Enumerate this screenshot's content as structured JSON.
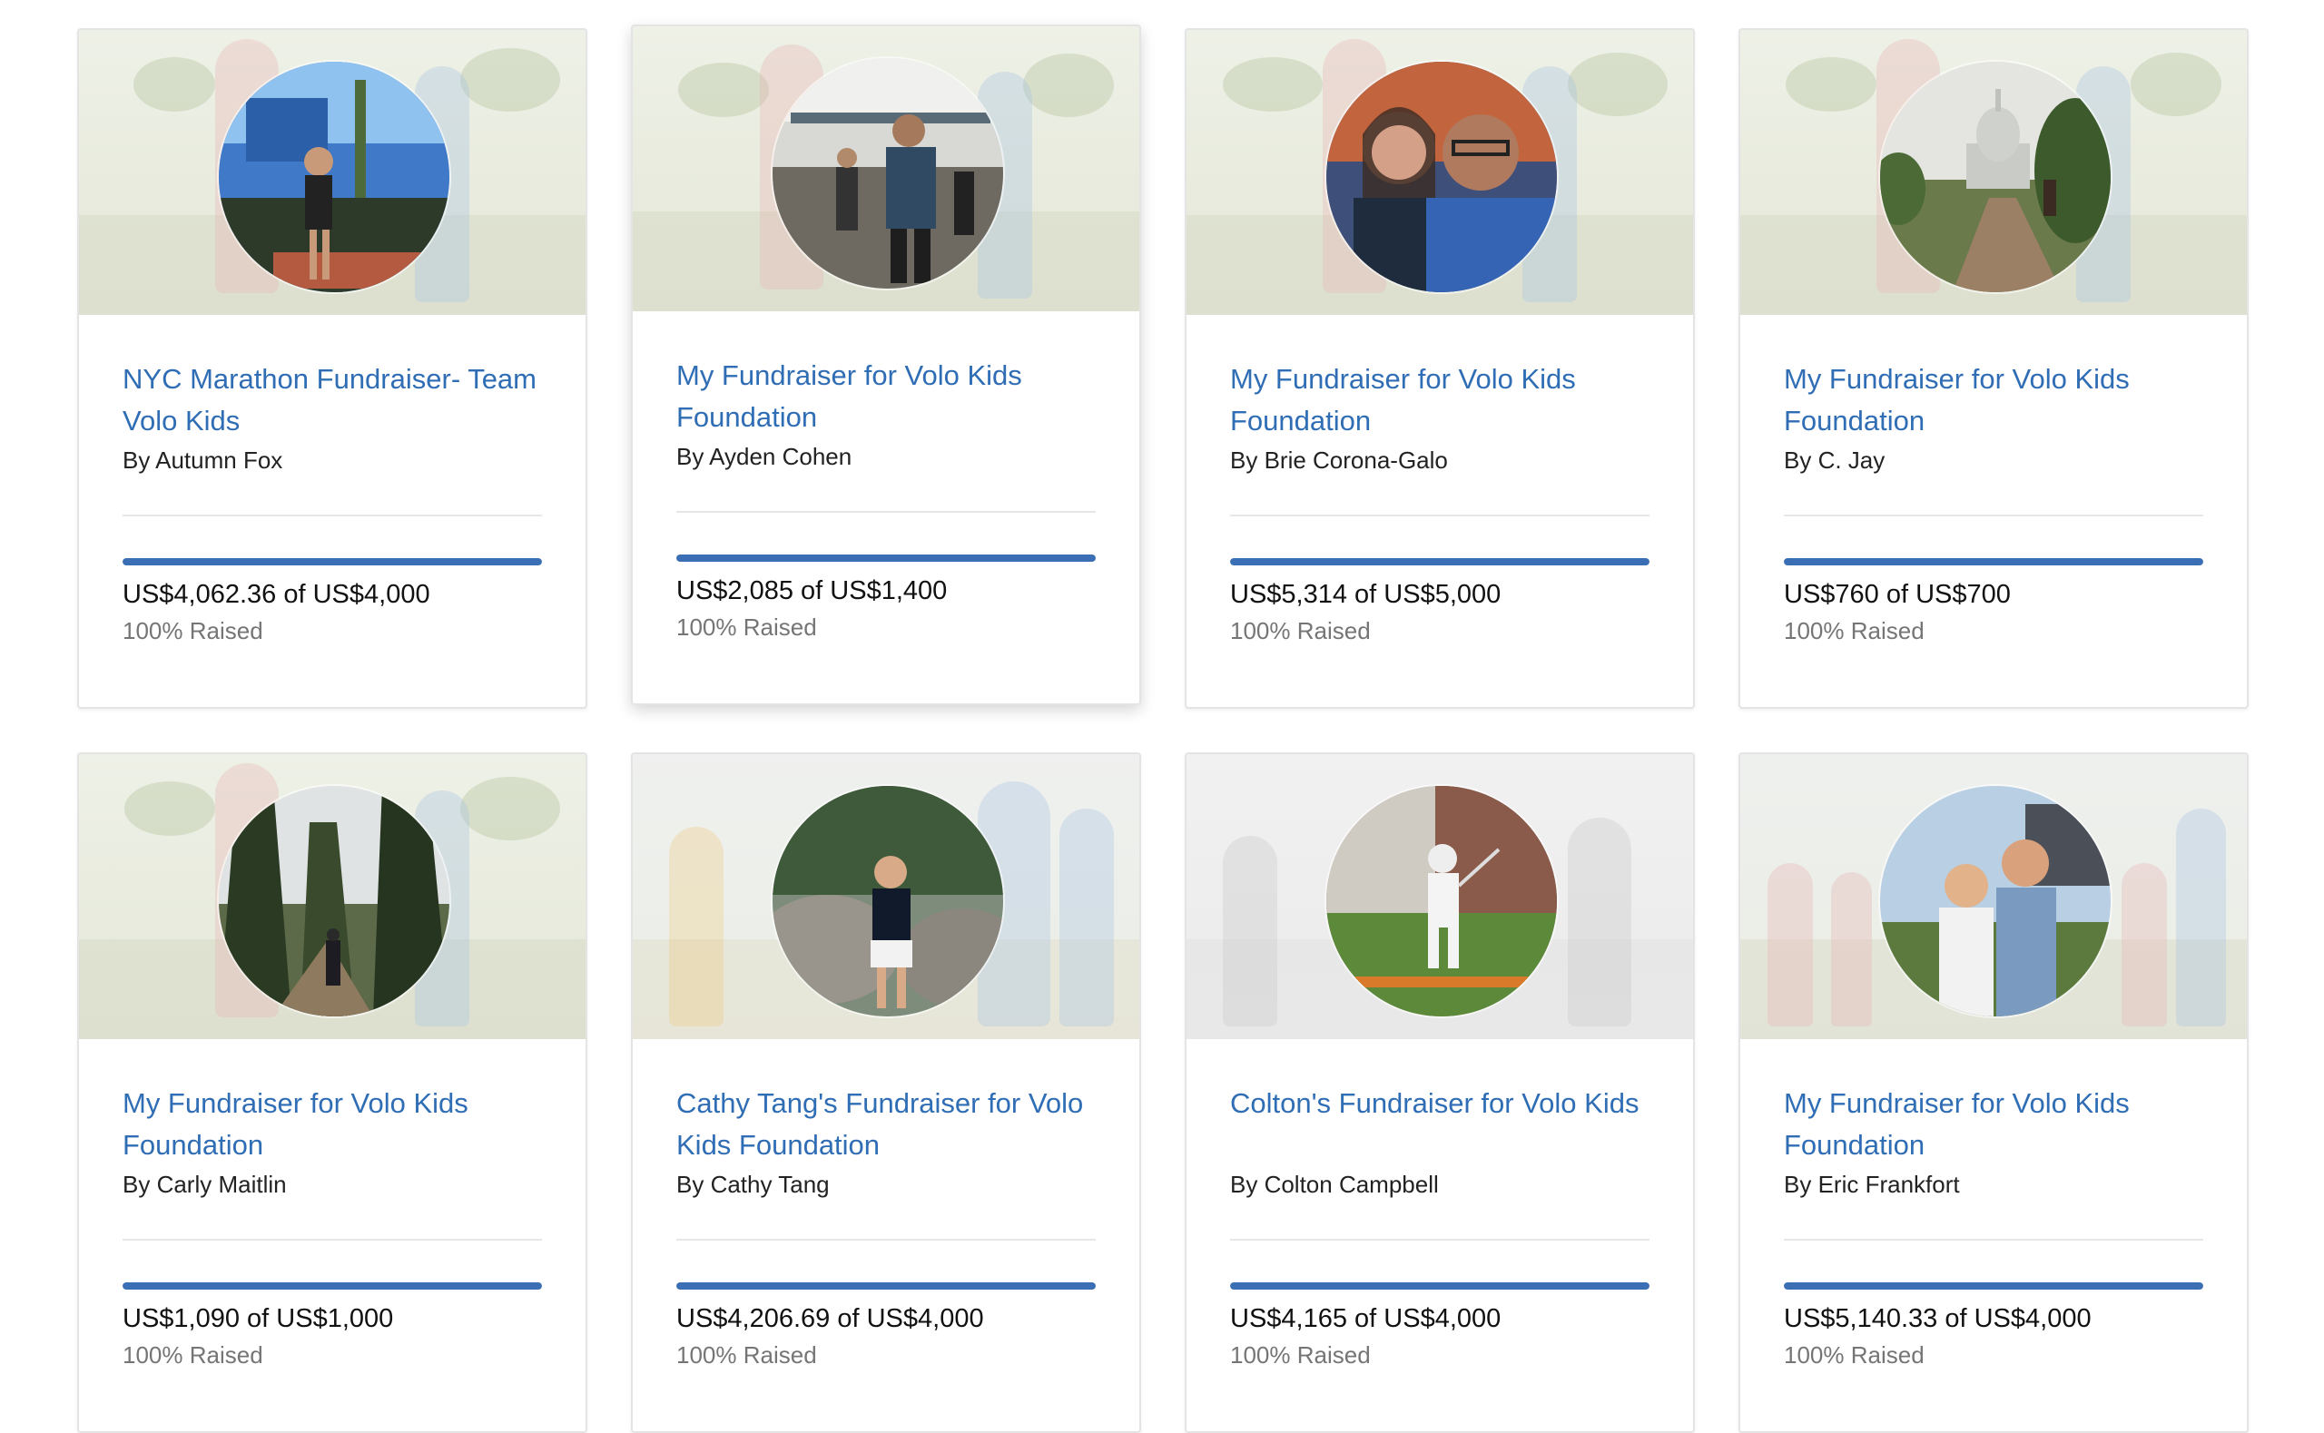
{
  "cards": [
    {
      "title": "NYC Marathon Fundraiser- Team Volo Kids",
      "author": "By Autumn Fox",
      "amount": "US$4,062.36 of US$4,000",
      "percent_label": "100% Raised",
      "progress": 1.0
    },
    {
      "title": "My Fundraiser for Volo Kids Foundation",
      "author": "By Ayden Cohen",
      "amount": "US$2,085 of US$1,400",
      "percent_label": "100% Raised",
      "progress": 1.0
    },
    {
      "title": "My Fundraiser for Volo Kids Foundation",
      "author": "By Brie Corona-Galo",
      "amount": "US$5,314 of US$5,000",
      "percent_label": "100% Raised",
      "progress": 1.0
    },
    {
      "title": "My Fundraiser for Volo Kids Foundation",
      "author": "By C. Jay",
      "amount": "US$760 of US$700",
      "percent_label": "100% Raised",
      "progress": 1.0
    },
    {
      "title": "My Fundraiser for Volo Kids Foundation",
      "author": "By Carly Maitlin",
      "amount": "US$1,090 of US$1,000",
      "percent_label": "100% Raised",
      "progress": 1.0
    },
    {
      "title": "Cathy Tang's Fundraiser for Volo Kids Foundation",
      "author": "By Cathy Tang",
      "amount": "US$4,206.69 of US$4,000",
      "percent_label": "100% Raised",
      "progress": 1.0
    },
    {
      "title": "Colton's Fundraiser for Volo Kids",
      "author": "By Colton Campbell",
      "amount": "US$4,165 of US$4,000",
      "percent_label": "100% Raised",
      "progress": 1.0
    },
    {
      "title": "My Fundraiser for Volo Kids Foundation",
      "author": "By Eric Frankfort",
      "amount": "US$5,140.33 of US$4,000",
      "percent_label": "100% Raised",
      "progress": 1.0
    }
  ],
  "colors": {
    "link": "#2f6db5",
    "progress": "#3a6fb5",
    "muted": "#757575"
  }
}
